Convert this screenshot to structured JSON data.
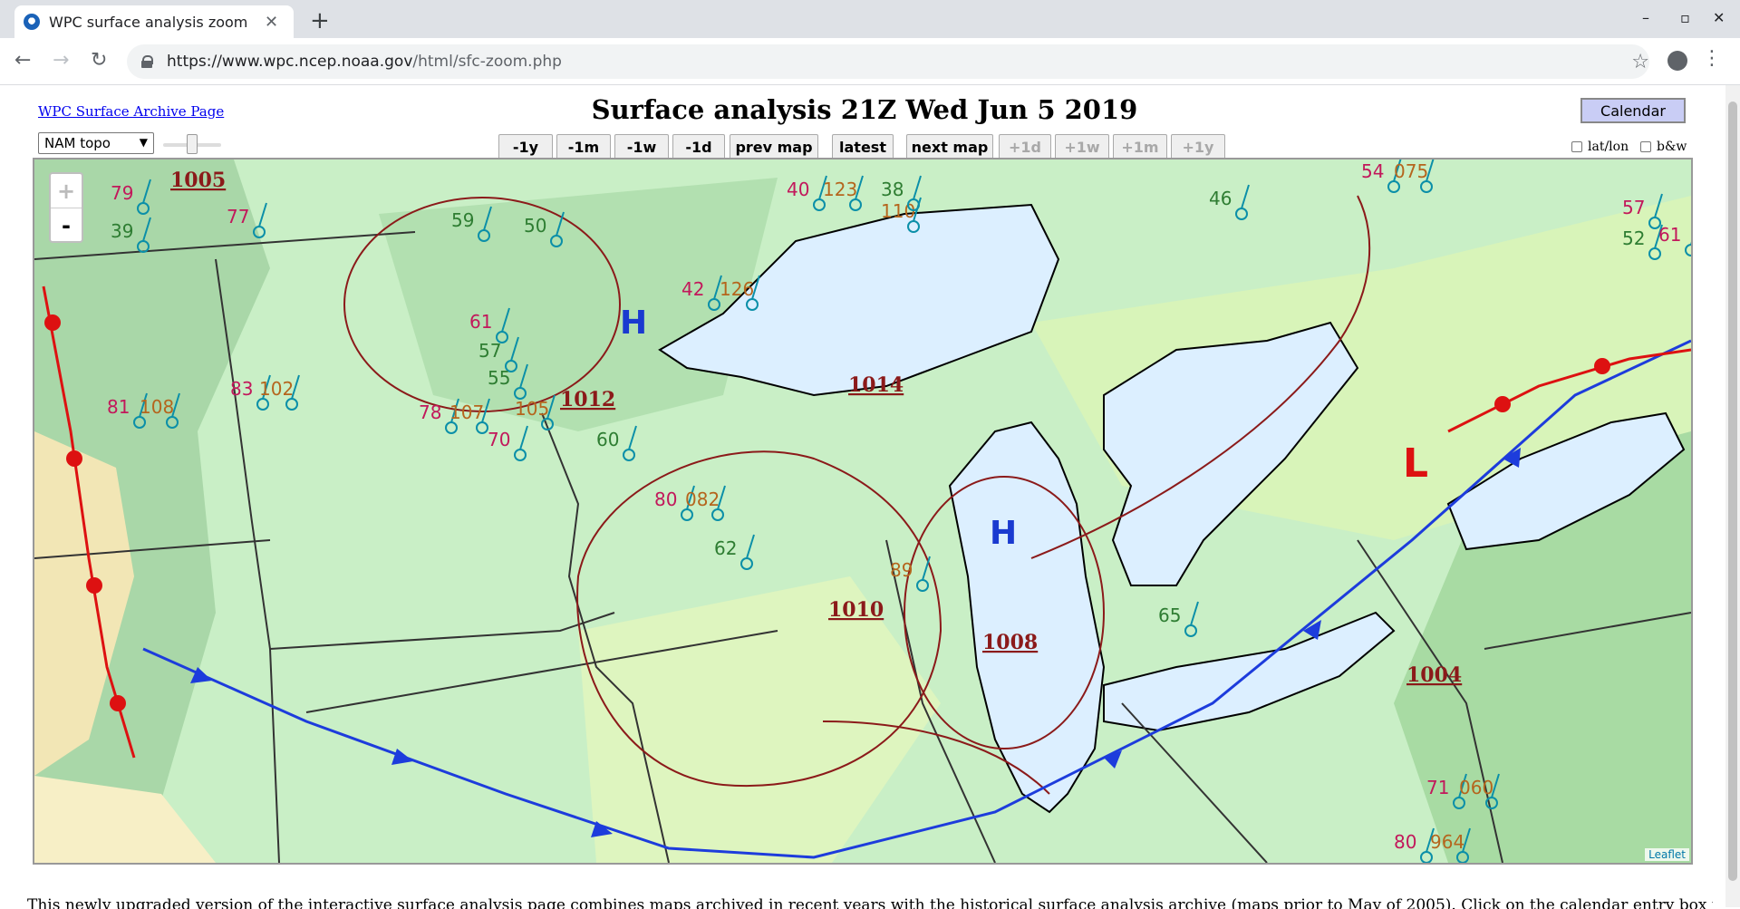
{
  "browser": {
    "tab_title": "WPC surface analysis zoom",
    "tab_close": "✕",
    "new_tab": "+",
    "url_host": "https://www.wpc.ncep.noaa.gov",
    "url_path": "/html/sfc-zoom.php",
    "controls": {
      "minimize": "–",
      "maximize": "▫",
      "close": "✕"
    }
  },
  "header": {
    "archive_link": "WPC Surface Archive Page",
    "title": "Surface analysis 21Z Wed Jun 5 2019",
    "calendar_button": "Calendar"
  },
  "controls": {
    "basemap_select": "NAM topo",
    "nav": {
      "minus_1y": "-1y",
      "minus_1m": "-1m",
      "minus_1w": "-1w",
      "minus_1d": "-1d",
      "prev_map": "prev map",
      "latest": "latest",
      "next_map": "next map",
      "plus_1d": "+1d",
      "plus_1w": "+1w",
      "plus_1m": "+1m",
      "plus_1y": "+1y"
    },
    "latlon_label": "lat/lon",
    "bw_label": "b&w"
  },
  "map": {
    "zoom_in": "+",
    "zoom_out": "-",
    "attribution": "Leaflet",
    "high_label": "H",
    "low_label": "L",
    "pressure_labels": [
      "1005",
      "1014",
      "1010",
      "1008",
      "1004",
      "1012"
    ],
    "station_values": [
      "79",
      "39",
      "77",
      "59",
      "50",
      "61",
      "57",
      "55",
      "42",
      "126",
      "40",
      "123",
      "110",
      "38",
      "46",
      "54",
      "075",
      "57",
      "52",
      "61",
      "81",
      "108",
      "83",
      "102",
      "78",
      "107",
      "70",
      "105",
      "60",
      "80",
      "082",
      "62",
      "89",
      "65",
      "71",
      "060",
      "80",
      "964"
    ]
  },
  "description": "This newly upgraded version of the interactive surface analysis page combines maps archived in recent years with the historical surface analysis archive (maps prior to May of 2005). Click on the calendar entry box near"
}
